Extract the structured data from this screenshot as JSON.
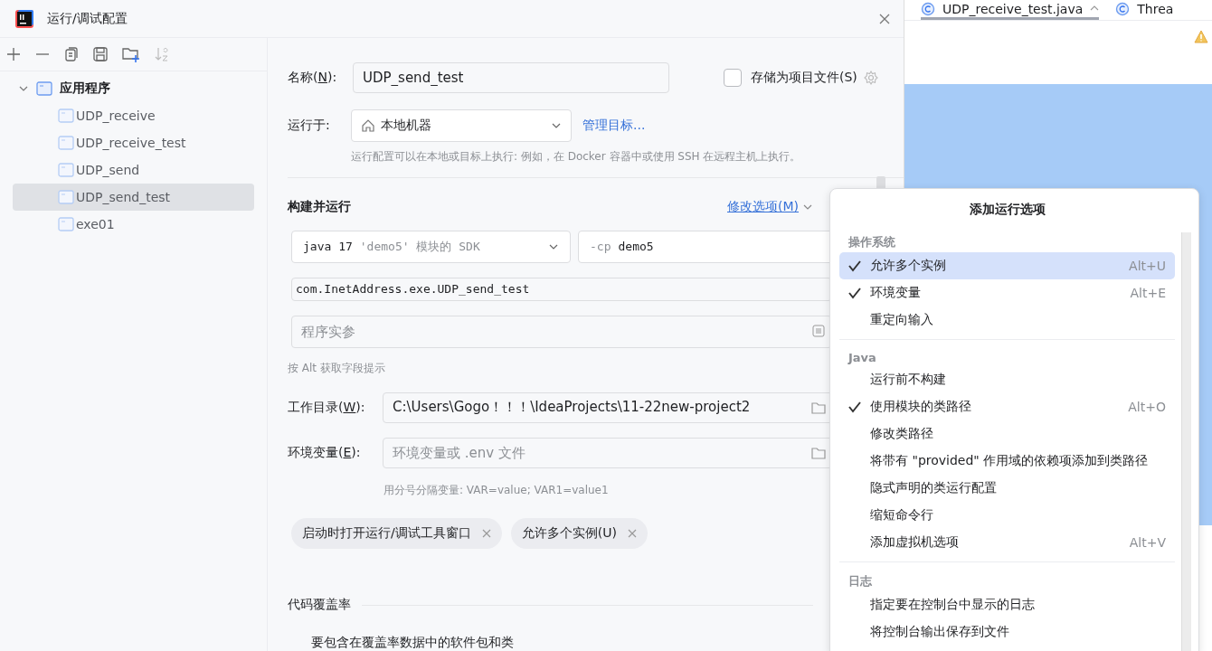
{
  "window": {
    "title": "运行/调试配置"
  },
  "tree": {
    "label": "应用程序",
    "expanded": true,
    "children": [
      {
        "label": "UDP_receive",
        "selected": false
      },
      {
        "label": "UDP_receive_test",
        "selected": false
      },
      {
        "label": "UDP_send",
        "selected": false
      },
      {
        "label": "UDP_send_test",
        "selected": true
      },
      {
        "label": "exe01",
        "selected": false
      }
    ]
  },
  "form": {
    "name": {
      "label": {
        "before": "名称(",
        "mnemonic": "N",
        "after": "):"
      },
      "value": "UDP_send_test"
    },
    "store": {
      "label": "存储为项目文件(S)",
      "checked": false
    },
    "run_on": {
      "label": "运行于:",
      "value": "本地机器",
      "link": "管理目标..."
    },
    "run_on_hint": "运行配置可以在本地或目标上执行: 例如，在 Docker 容器中或使用 SSH 在远程主机上执行。",
    "section": "构建并运行",
    "modify_link": "修改选项(M)",
    "sdk": {
      "value": "java 17",
      "hint": "'demo5' 模块的 SDK"
    },
    "classpath": {
      "prefix": "-cp",
      "value": "demo5"
    },
    "main_class": "com.InetAddress.exe.UDP_send_test",
    "args": {
      "placeholder": "程序实参"
    },
    "alt_hint": "按 Alt 获取字段提示",
    "workdir": {
      "label": {
        "before": "工作目录(",
        "mnemonic": "W",
        "after": "):"
      },
      "value": "C:\\Users\\Gogo！！！\\IdeaProjects\\11-22new-project2"
    },
    "env": {
      "label": {
        "before": "环境变量(",
        "mnemonic": "E",
        "after": "):"
      },
      "placeholder": "环境变量或 .env 文件"
    },
    "env_hint": "用分号分隔变量: VAR=value; VAR1=value1",
    "chips": [
      "启动时打开运行/调试工具窗口",
      "允许多个实例(U)"
    ],
    "coverage": {
      "title": "代码覆盖率",
      "subtitle": "要包含在覆盖率数据中的软件包和类"
    }
  },
  "editor": {
    "tabs": [
      {
        "label": "UDP_receive_test.java",
        "selected": true
      },
      {
        "label": "Threa",
        "selected": false
      }
    ]
  },
  "popup": {
    "title": "添加运行选项",
    "sections": [
      {
        "header": "操作系统",
        "items": [
          {
            "label": "允许多个实例",
            "checked": true,
            "shortcut": "Alt+U",
            "selected": true
          },
          {
            "label": "环境变量",
            "checked": true,
            "shortcut": "Alt+E",
            "selected": false
          },
          {
            "label": "重定向输入",
            "checked": false,
            "selected": false
          }
        ]
      },
      {
        "header": "Java",
        "items": [
          {
            "label": "运行前不构建",
            "checked": false,
            "selected": false
          },
          {
            "label": "使用模块的类路径",
            "checked": true,
            "shortcut": "Alt+O",
            "selected": false
          },
          {
            "label": "修改类路径",
            "checked": false,
            "selected": false
          },
          {
            "label": "将带有 \"provided\" 作用域的依赖项添加到类路径",
            "checked": false,
            "selected": false
          },
          {
            "label": "隐式声明的类运行配置",
            "checked": false,
            "selected": false
          },
          {
            "label": "缩短命令行",
            "checked": false,
            "selected": false
          },
          {
            "label": "添加虚拟机选项",
            "checked": false,
            "shortcut": "Alt+V",
            "selected": false
          }
        ]
      },
      {
        "header": "日志",
        "items": [
          {
            "label": "指定要在控制台中显示的日志",
            "checked": false,
            "selected": false
          },
          {
            "label": "将控制台输出保存到文件",
            "checked": false,
            "selected": false
          }
        ]
      }
    ]
  }
}
